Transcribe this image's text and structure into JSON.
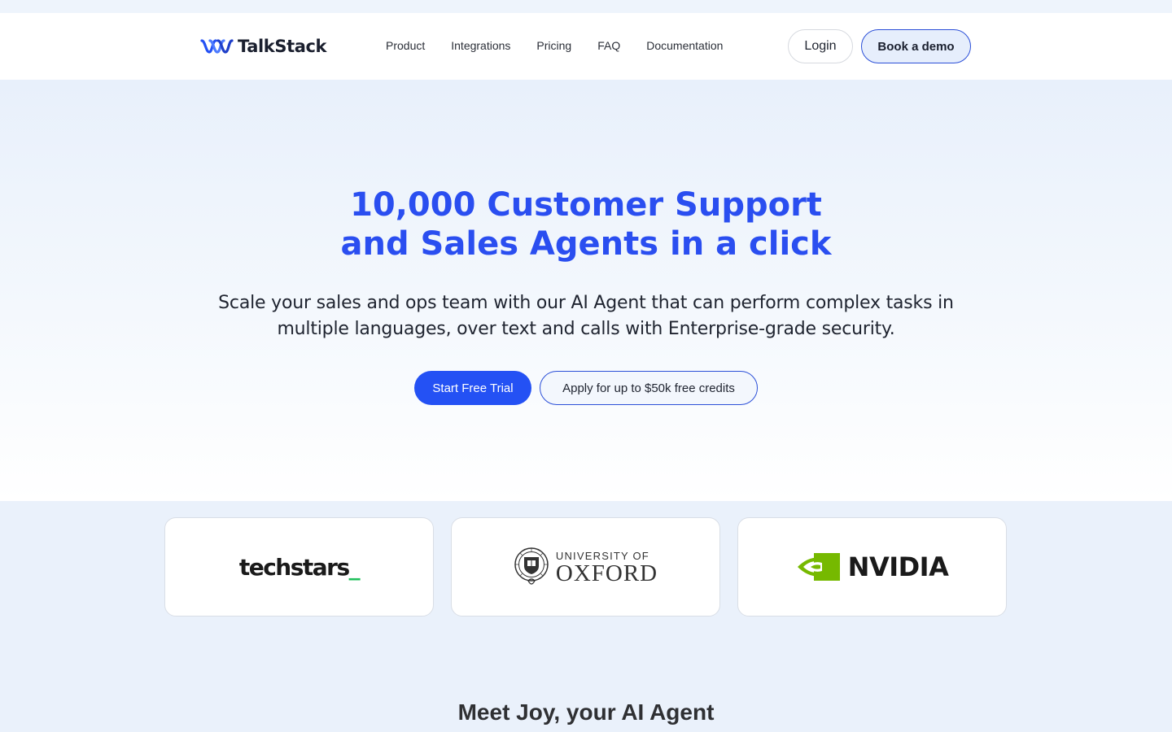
{
  "brand": {
    "name": "TalkStack",
    "accent": "#2451f4"
  },
  "nav": {
    "items": [
      {
        "label": "Product"
      },
      {
        "label": "Integrations"
      },
      {
        "label": "Pricing"
      },
      {
        "label": "FAQ"
      },
      {
        "label": "Documentation"
      }
    ],
    "login_label": "Login",
    "demo_label": "Book a demo"
  },
  "hero": {
    "title_line1": "10,000 Customer Support",
    "title_line2": "and Sales Agents in a click",
    "subtitle": "Scale your sales and ops team with our AI Agent that can perform complex tasks in multiple languages, over text and calls with Enterprise-grade security.",
    "primary_cta": "Start Free Trial",
    "secondary_cta": "Apply for up to $50k free credits"
  },
  "partners": {
    "techstars": {
      "word": "techstars",
      "suffix": "_"
    },
    "oxford": {
      "top": "UNIVERSITY OF",
      "main": "OXFORD"
    },
    "nvidia": {
      "word": "NVIDIA"
    }
  },
  "section": {
    "heading": "Meet Joy, your AI Agent"
  }
}
